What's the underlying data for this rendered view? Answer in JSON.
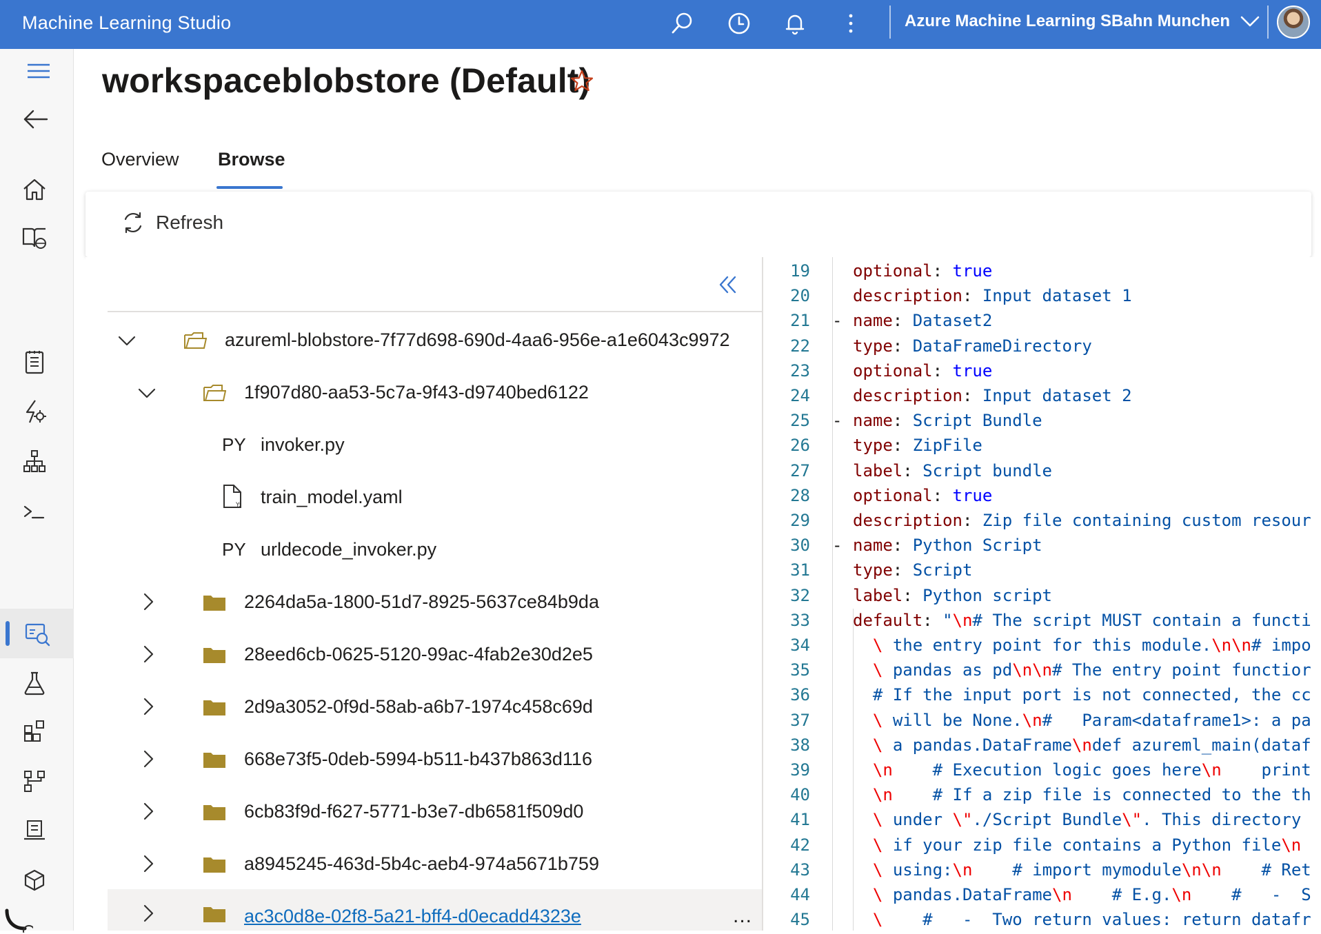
{
  "topbar": {
    "app_title": "Machine Learning Studio",
    "workspace": "Azure Machine Learning SBahn Munchen",
    "bg_color": "#3a76cf",
    "icons": [
      "search-icon",
      "history-icon",
      "bell-icon",
      "more-vertical-icon",
      "chevron-down-icon",
      "avatar"
    ]
  },
  "header": {
    "title": "workspaceblobstore (Default)",
    "tabs": [
      {
        "label": "Overview",
        "active": false
      },
      {
        "label": "Browse",
        "active": true
      }
    ]
  },
  "commands": {
    "refresh_label": "Refresh"
  },
  "tree": {
    "items": [
      {
        "label": "azureml-blobstore-7f77d698-690d-4aa6-956e-a1e6043c9972",
        "type": "folder-open",
        "expanded": true
      },
      {
        "label": "1f907d80-aa53-5c7a-9f43-d9740bed6122",
        "type": "folder-open",
        "expanded": true
      },
      {
        "label": "invoker.py",
        "type": "py",
        "badge": "PY"
      },
      {
        "label": "train_model.yaml",
        "type": "yaml"
      },
      {
        "label": "urldecode_invoker.py",
        "type": "py",
        "badge": "PY"
      },
      {
        "label": "2264da5a-1800-51d7-8925-5637ce84b9da",
        "type": "folder",
        "expanded": false
      },
      {
        "label": "28eed6cb-0625-5120-99ac-4fab2e30d2e5",
        "type": "folder",
        "expanded": false
      },
      {
        "label": "2d9a3052-0f9d-58ab-a6b7-1974c458c69d",
        "type": "folder",
        "expanded": false
      },
      {
        "label": "668e73f5-0deb-5994-b511-b437b863d116",
        "type": "folder",
        "expanded": false
      },
      {
        "label": "6cb83f9d-f627-5771-b3e7-db6581f509d0",
        "type": "folder",
        "expanded": false
      },
      {
        "label": "a8945245-463d-5b4c-aeb4-974a5671b759",
        "type": "folder",
        "expanded": false
      },
      {
        "label": "ac3c0d8e-02f8-5a21-bff4-d0ecadd4323e",
        "type": "folder",
        "expanded": false,
        "hovered": true,
        "more": "..."
      }
    ]
  },
  "code": {
    "lines": [
      {
        "n": "19",
        "fold": "",
        "text": "optional: true"
      },
      {
        "n": "20",
        "fold": "",
        "text": "description: Input dataset 1"
      },
      {
        "n": "21",
        "fold": "-",
        "text": "name: Dataset2"
      },
      {
        "n": "22",
        "fold": "",
        "text": "type: DataFrameDirectory"
      },
      {
        "n": "23",
        "fold": "",
        "text": "optional: true"
      },
      {
        "n": "24",
        "fold": "",
        "text": "description: Input dataset 2"
      },
      {
        "n": "25",
        "fold": "-",
        "text": "name: Script Bundle"
      },
      {
        "n": "26",
        "fold": "",
        "text": "type: ZipFile"
      },
      {
        "n": "27",
        "fold": "",
        "text": "label: Script bundle"
      },
      {
        "n": "28",
        "fold": "",
        "text": "optional: true"
      },
      {
        "n": "29",
        "fold": "",
        "text": "description: Zip file containing custom resour"
      },
      {
        "n": "30",
        "fold": "-",
        "text": "name: Python Script"
      },
      {
        "n": "31",
        "fold": "",
        "text": "type: Script"
      },
      {
        "n": "32",
        "fold": "",
        "text": "label: Python script"
      },
      {
        "n": "33",
        "fold": "",
        "text": "default: \"\\n# The script MUST contain a functi"
      },
      {
        "n": "34",
        "fold": "",
        "text": "  \\ the entry point for this module.\\n\\n# impo"
      },
      {
        "n": "35",
        "fold": "",
        "text": "  \\ pandas as pd\\n\\n# The entry point functior"
      },
      {
        "n": "36",
        "fold": "",
        "text": "  # If the input port is not connected, the cc"
      },
      {
        "n": "37",
        "fold": "",
        "text": "  \\ will be None.\\n#   Param<dataframe1>: a pa"
      },
      {
        "n": "38",
        "fold": "",
        "text": "  \\ a pandas.DataFrame\\ndef azureml_main(dataf"
      },
      {
        "n": "39",
        "fold": "",
        "text": "  \\n    # Execution logic goes here\\n    print"
      },
      {
        "n": "40",
        "fold": "",
        "text": "  \\n    # If a zip file is connected to the th"
      },
      {
        "n": "41",
        "fold": "",
        "text": "  \\ under \\\"./Script Bundle\\\". This directory"
      },
      {
        "n": "42",
        "fold": "",
        "text": "  \\ if your zip file contains a Python file\\n"
      },
      {
        "n": "43",
        "fold": "",
        "text": "  \\ using:\\n    # import mymodule\\n\\n    # Ret"
      },
      {
        "n": "44",
        "fold": "",
        "text": "  \\ pandas.DataFrame\\n    # E.g.\\n    #   -  S"
      },
      {
        "n": "45",
        "fold": "",
        "text": "  \\    #   -  Two return values: return datafr"
      }
    ]
  }
}
